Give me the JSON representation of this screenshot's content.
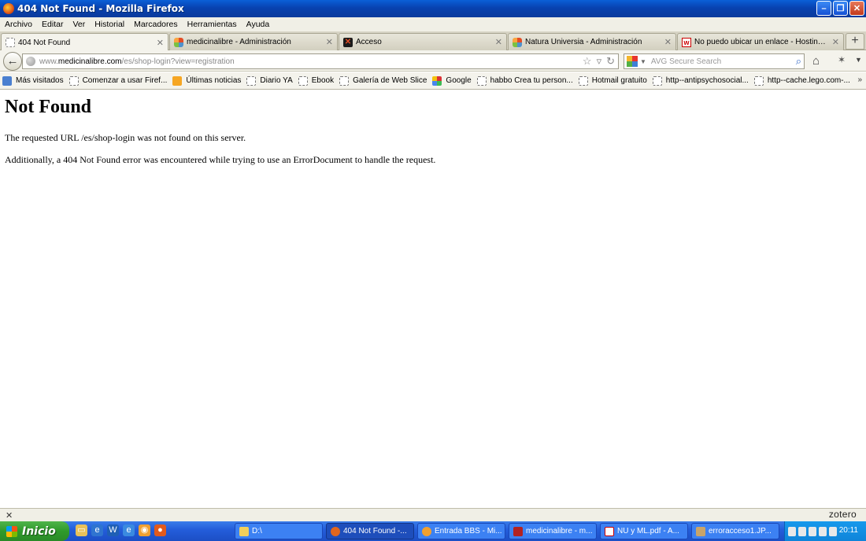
{
  "window": {
    "title": "404 Not Found - Mozilla Firefox"
  },
  "menu": [
    "Archivo",
    "Editar",
    "Ver",
    "Historial",
    "Marcadores",
    "Herramientas",
    "Ayuda"
  ],
  "tabs": [
    {
      "label": "404 Not Found",
      "icon": "blank-page-icon",
      "active": true
    },
    {
      "label": "medicinalibre - Administración",
      "icon": "joomla-icon"
    },
    {
      "label": "Acceso",
      "icon": "acceso-icon"
    },
    {
      "label": "Natura Universia - Administración",
      "icon": "joomla-icon"
    },
    {
      "label": "No puedo ubicar un enlace - Hosting Joo...",
      "icon": "hosting-w-icon"
    }
  ],
  "nav": {
    "url_prefix": "www.",
    "url_host": "medicinalibre.com",
    "url_path": "/es/shop-login?view=registration",
    "search_placeholder": "AVG Secure Search"
  },
  "bookmarks": [
    {
      "label": "Más visitados",
      "icon": "most-visited-icon"
    },
    {
      "label": "Comenzar a usar Firef...",
      "icon": "blank-page-icon"
    },
    {
      "label": "Últimas noticias",
      "icon": "rss-feed-icon"
    },
    {
      "label": "Diario YA",
      "icon": "blank-page-icon"
    },
    {
      "label": "Ebook",
      "icon": "blank-page-icon"
    },
    {
      "label": "Galería de Web Slice",
      "icon": "blank-page-icon"
    },
    {
      "label": "Google",
      "icon": "google-icon"
    },
    {
      "label": "habbo Crea tu person...",
      "icon": "blank-page-icon"
    },
    {
      "label": "Hotmail gratuito",
      "icon": "blank-page-icon"
    },
    {
      "label": "http--antipsychosocial...",
      "icon": "blank-page-icon"
    },
    {
      "label": "http--cache.lego.com-...",
      "icon": "blank-page-icon"
    }
  ],
  "page": {
    "heading": "Not Found",
    "line1": "The requested URL /es/shop-login was not found on this server.",
    "line2": "Additionally, a 404 Not Found error was encountered while trying to use an ErrorDocument to handle the request."
  },
  "addon_bar": {
    "zotero": "zotero"
  },
  "taskbar": {
    "start": "Inicio",
    "tasks": [
      {
        "label": "D:\\",
        "icon": "folder-icon"
      },
      {
        "label": "404 Not Found -...",
        "icon": "firefox-icon",
        "active": true
      },
      {
        "label": "Entrada BBS - Mi...",
        "icon": "browser-icon"
      },
      {
        "label": "medicinalibre - m...",
        "icon": "filezilla-icon"
      },
      {
        "label": "NU y ML.pdf - A...",
        "icon": "pdf-icon"
      },
      {
        "label": "erroracceso1.JP...",
        "icon": "image-viewer-icon"
      }
    ],
    "clock": "20:11"
  }
}
